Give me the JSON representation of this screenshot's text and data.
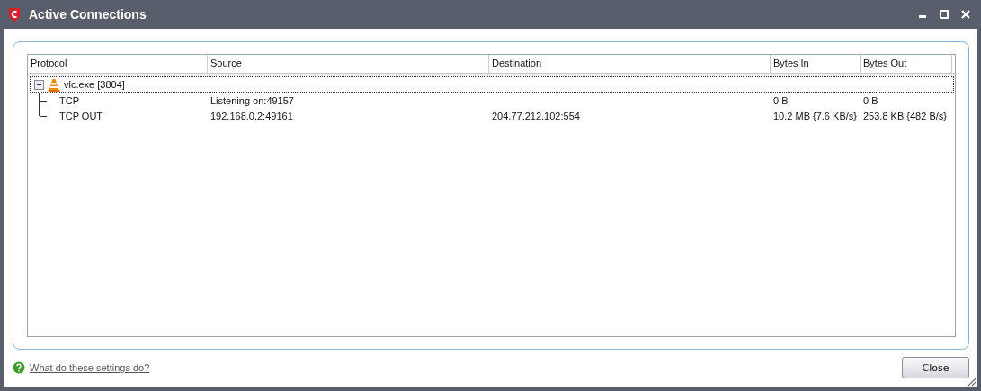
{
  "window": {
    "title": "Active Connections"
  },
  "table": {
    "columns": [
      "Protocol",
      "Source",
      "Destination",
      "Bytes In",
      "Bytes Out"
    ],
    "processes": [
      {
        "name": "vlc.exe [3804]",
        "expanded": true,
        "focused": true,
        "children": [
          {
            "protocol": "TCP",
            "source": "Listening on:49157",
            "bytes_in": "0 B",
            "bytes_out": "0 B"
          },
          {
            "protocol": "TCP OUT",
            "source": "192.168.0.2:49161",
            "destination": "204.77.212.102:554",
            "bytes_in": "10.2 MB {7.6 KB/s}",
            "bytes_out": "253.8 KB {482 B/s}"
          }
        ]
      }
    ]
  },
  "help_link": "What do these settings do?",
  "buttons": [
    "Close"
  ]
}
